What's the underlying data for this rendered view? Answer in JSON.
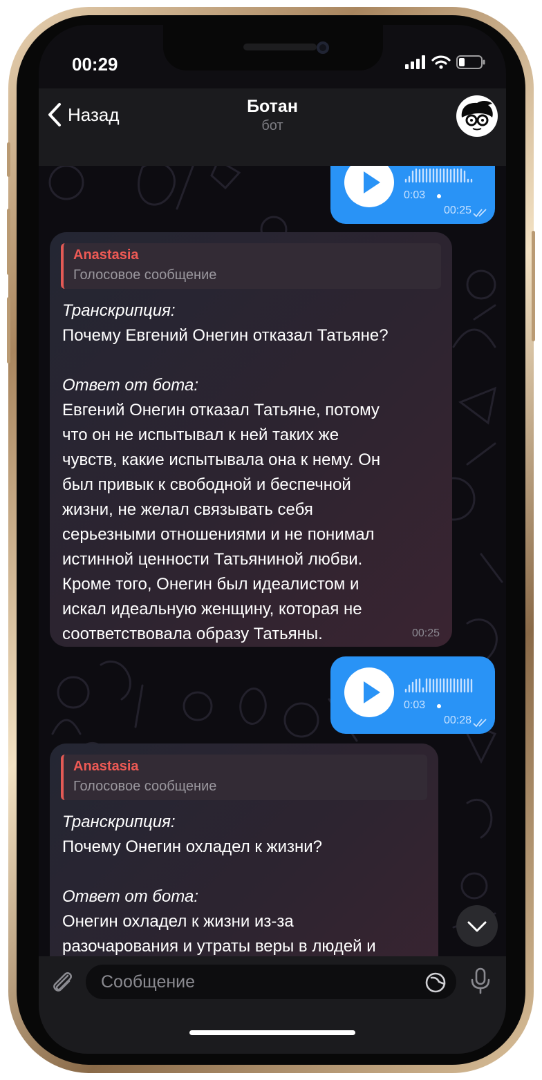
{
  "status": {
    "time": "00:29"
  },
  "nav": {
    "back_label": "Назад",
    "title": "Ботан",
    "subtitle": "бот"
  },
  "messages": [
    {
      "type": "voice_out",
      "duration": "0:03",
      "time": "00:25"
    },
    {
      "type": "text_in",
      "reply_name": "Anastasia",
      "reply_text": "Голосовое сообщение",
      "lines": [
        "Транскрипция:",
        "Почему Евгений Онегин отказал Татьяне?",
        "",
        "Ответ от бота:",
        "Евгений Онегин отказал Татьяне, потому",
        "что он не испытывал к ней таких же",
        "чувств, какие испытывала она к нему. Он",
        "был привык к свободной и беспечной",
        "жизни, не желал связывать себя",
        "серьезными отношениями и не понимал",
        "истинной ценности Татьяниной любви.",
        "Кроме того, Онегин был идеалистом и",
        "искал идеальную женщину, которая не",
        "соответствовала образу Татьяны."
      ],
      "time": "00:25"
    },
    {
      "type": "voice_out",
      "duration": "0:03",
      "time": "00:28"
    },
    {
      "type": "text_in",
      "reply_name": "Anastasia",
      "reply_text": "Голосовое сообщение",
      "lines": [
        "Транскрипция:",
        "Почему Онегин охладел к жизни?",
        "",
        "Ответ от бота:",
        "Онегин охладел к жизни из-за",
        "разочарования и утраты веры в людей и"
      ]
    }
  ],
  "input": {
    "placeholder": "Сообщение"
  },
  "icons": {
    "back": "chevron-left-icon",
    "avatar": "nerd-glasses-avatar",
    "play": "play-icon",
    "read": "double-check-icon",
    "scroll": "chevron-down-icon",
    "attach": "paperclip-icon",
    "sticker": "sticker-icon",
    "mic": "microphone-icon"
  },
  "colors": {
    "accent": "#2993f6",
    "reply_name": "#ef5a55",
    "nav_bg": "#1b1b1e",
    "incoming_bubble": "#2a2531"
  }
}
